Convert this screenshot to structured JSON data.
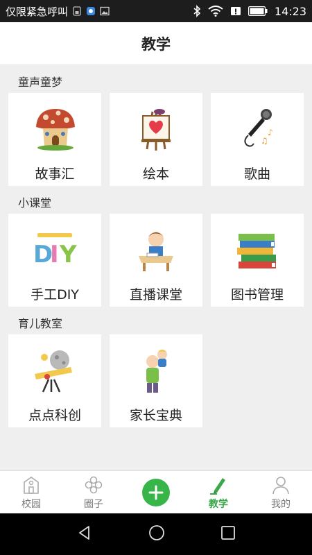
{
  "status_bar": {
    "carrier": "仅限紧急呼叫",
    "time": "14:23"
  },
  "header": {
    "title": "教学"
  },
  "sections": [
    {
      "title": "童声童梦",
      "items": [
        {
          "label": "故事汇",
          "icon": "mushroom-house-icon"
        },
        {
          "label": "绘本",
          "icon": "easel-heart-icon"
        },
        {
          "label": "歌曲",
          "icon": "microphone-icon"
        }
      ]
    },
    {
      "title": "小课堂",
      "items": [
        {
          "label": "手工DIY",
          "icon": "diy-text-icon"
        },
        {
          "label": "直播课堂",
          "icon": "student-desk-icon"
        },
        {
          "label": "图书管理",
          "icon": "book-stack-icon"
        }
      ]
    },
    {
      "title": "育儿教室",
      "items": [
        {
          "label": "点点科创",
          "icon": "telescope-icon"
        },
        {
          "label": "家长宝典",
          "icon": "parent-child-icon"
        }
      ]
    }
  ],
  "bottom_nav": {
    "items": [
      {
        "label": "校园",
        "icon": "school-icon"
      },
      {
        "label": "圈子",
        "icon": "circle-icon"
      },
      {
        "label": "",
        "icon": "plus-icon"
      },
      {
        "label": "教学",
        "icon": "pen-icon",
        "active": true
      },
      {
        "label": "我的",
        "icon": "person-icon"
      }
    ]
  },
  "colors": {
    "accent": "#38b548",
    "active_label": "#3aa84a",
    "statusbar": "#1d1d1d"
  }
}
